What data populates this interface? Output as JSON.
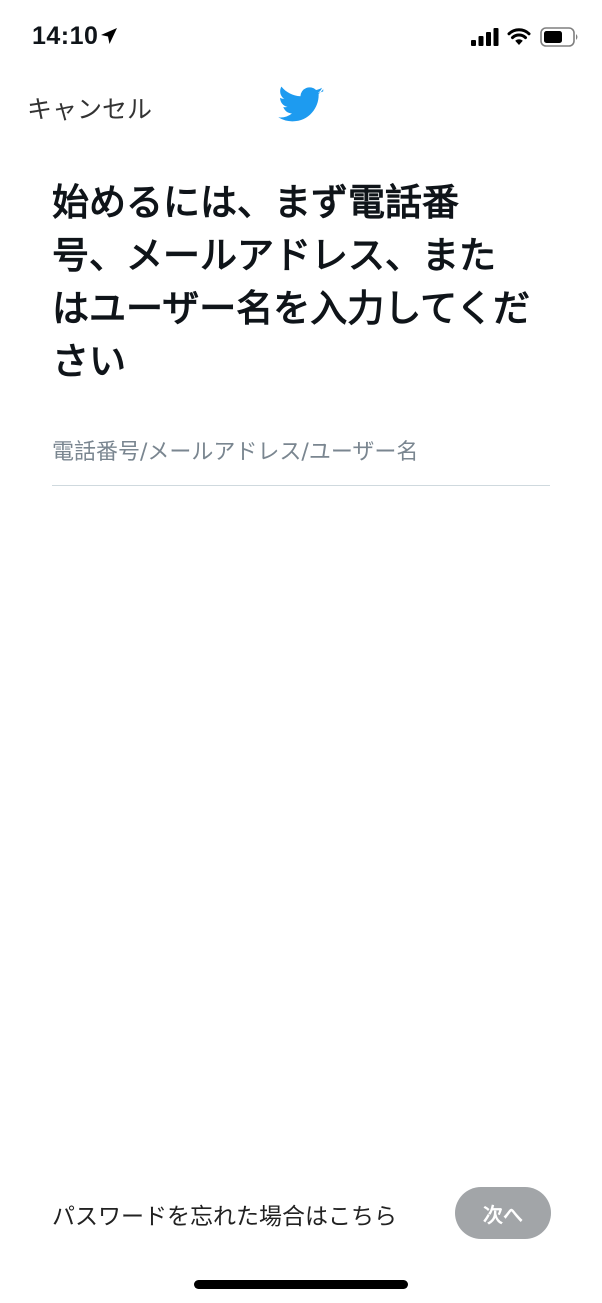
{
  "status_bar": {
    "time": "14:10",
    "icons": [
      "location-arrow-icon",
      "cellular-signal-icon",
      "wifi-icon",
      "battery-icon"
    ]
  },
  "nav": {
    "cancel_label": "キャンセル",
    "logo_icon": "twitter-bird-icon",
    "brand_color": "#1D9BF0"
  },
  "main": {
    "title": "始めるには、まず電話番号、メールアドレス、またはユーザー名を入力してください",
    "input_placeholder": "電話番号/メールアドレス/ユーザー名",
    "input_value": ""
  },
  "footer": {
    "forgot_label": "パスワードを忘れた場合はこちら",
    "next_label": "次へ",
    "next_disabled_color": "#A2A5A8"
  }
}
